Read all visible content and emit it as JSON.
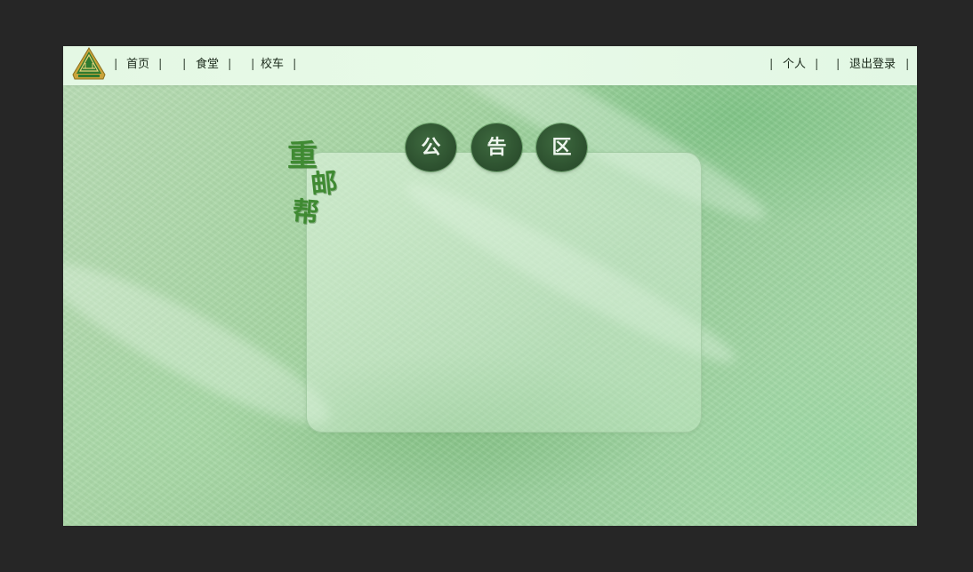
{
  "nav": {
    "home": "首页",
    "canteen": "食堂",
    "bus": "校车",
    "profile": "个人",
    "logout": "退出登录",
    "separator": "|"
  },
  "brand": {
    "char1": "重",
    "char2": "邮",
    "char3": "帮"
  },
  "announcement": {
    "title_chars": [
      "公",
      "告",
      "区"
    ]
  },
  "colors": {
    "accent": "#2c4f2e",
    "navbar_bg": "#e6f9e6",
    "page_bg": "#a6d5a3",
    "brand_green": "#3f8a32"
  },
  "icons": {
    "logo": "university-emblem-icon"
  }
}
